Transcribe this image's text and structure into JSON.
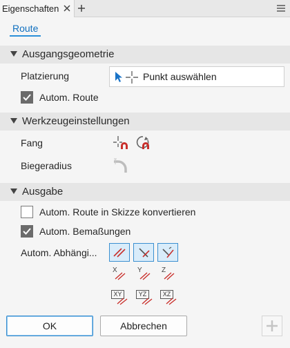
{
  "tabs": {
    "active_tab": "Eigenschaften"
  },
  "subtab": "Route",
  "sections": [
    {
      "title": "Ausgangsgeometrie"
    },
    {
      "title": "Werkzeugeinstellungen"
    },
    {
      "title": "Ausgabe"
    }
  ],
  "ausgangsgeometrie": {
    "placement_label": "Platzierung",
    "pick_text": "Punkt auswählen",
    "auto_route_label": "Autom. Route",
    "auto_route_checked": true
  },
  "werkzeug": {
    "snap_label": "Fang",
    "bend_label": "Biegeradius"
  },
  "ausgabe": {
    "convert_label": "Autom. Route in Skizze konvertieren",
    "convert_checked": false,
    "dims_label": "Autom. Bemaßungen",
    "dims_checked": true,
    "constraints_label": "Autom. Abhängi...",
    "axis_labels": [
      "X",
      "Y",
      "Z"
    ],
    "plane_labels": [
      "XY",
      "YZ",
      "XZ"
    ]
  },
  "buttons": {
    "ok": "OK",
    "cancel": "Abbrechen"
  },
  "colors": {
    "accent": "#2b8fd8",
    "icon_red": "#c9302c",
    "selected_bg": "#d9ecfa"
  },
  "icons": [
    "close-icon",
    "add-tab-icon",
    "menu-icon",
    "cursor-icon",
    "crosshair-icon",
    "snap-point-icon",
    "snap-rotate-icon",
    "bend-radius-icon",
    "parallel-constraint-icon",
    "perpendicular-constraint-icon",
    "angle-constraint-icon",
    "plus-icon"
  ]
}
